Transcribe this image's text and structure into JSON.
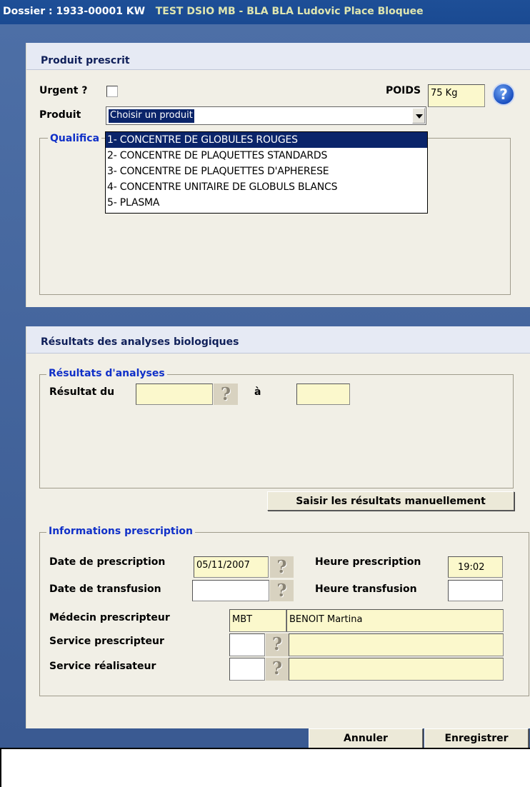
{
  "window": {
    "title_prefix": "Dossier : 1933-00001 KW",
    "title_highlight": "TEST DSIO MB - BLA BLA Ludovic Place Bloquee"
  },
  "produit_section": {
    "title": "Produit prescrit",
    "urgent_label": "Urgent ?",
    "urgent_checked": false,
    "poids_label": "POIDS",
    "poids_value": "75 Kg",
    "produit_label": "Produit",
    "produit_value": "Choisir un produit",
    "qualification_label": "Qualifica",
    "dropdown_options": [
      "1- CONCENTRE DE GLOBULES ROUGES",
      "2- CONCENTRE DE PLAQUETTES STANDARDS",
      "3- CONCENTRE DE PLAQUETTES D'APHERESE",
      "4- CONCENTRE UNITAIRE DE GLOBULS BLANCS",
      "5- PLASMA"
    ]
  },
  "resultats_section": {
    "title": "Résultats des analyses biologiques",
    "group_title": "Résultats d'analyses",
    "resultat_du_label": "Résultat du",
    "a_label": "à",
    "saisir_button": "Saisir les résultats manuellement"
  },
  "prescription_section": {
    "group_title": "Informations prescription",
    "date_prescription_label": "Date de prescription",
    "date_prescription_value": "05/11/2007",
    "heure_prescription_label": "Heure prescription",
    "heure_prescription_value": "19:02",
    "date_transfusion_label": "Date de transfusion",
    "heure_transfusion_label": "Heure transfusion",
    "medecin_label": "Médecin prescripteur",
    "medecin_code": "MBT",
    "medecin_name": "BENOIT Martina",
    "service_prescripteur_label": "Service prescripteur",
    "service_realisateur_label": "Service réalisateur"
  },
  "actions": {
    "annuler": "Annuler",
    "enregistrer": "Enregistrer"
  },
  "icons": {
    "help": "help-icon",
    "question": "question-mark-icon"
  },
  "colors": {
    "title_bar": "#1e4f97",
    "field_bg": "#fbf8cc",
    "panel_bg": "#f1efe6",
    "group_title": "#1030c8",
    "selection": "#0a246a"
  }
}
